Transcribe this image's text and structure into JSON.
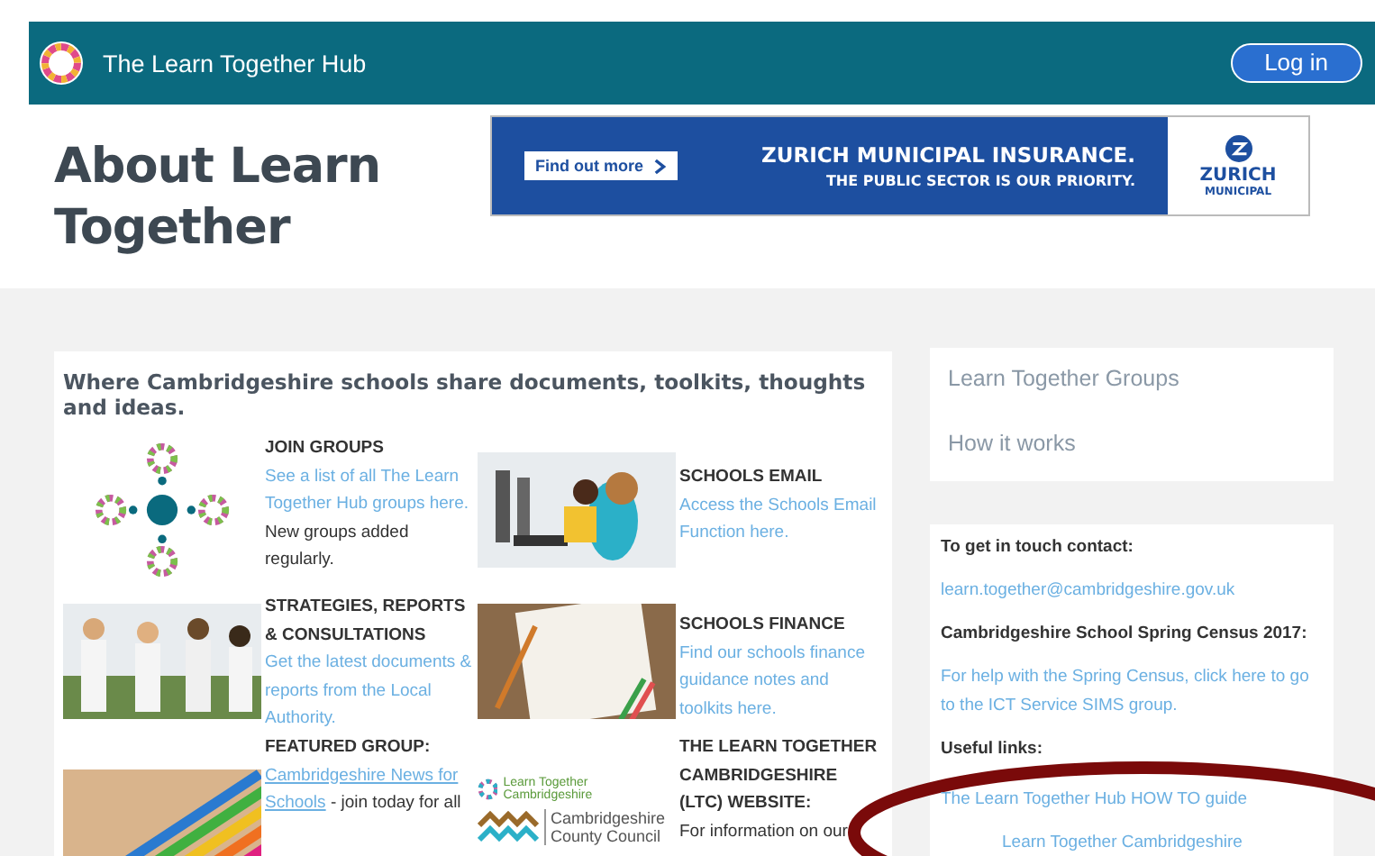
{
  "header": {
    "site_name": "The Learn Together Hub",
    "login": "Log in"
  },
  "page_title": "About Learn Together",
  "ad": {
    "button": "Find out more",
    "headline": "ZURICH MUNICIPAL INSURANCE.",
    "tagline": "THE PUBLIC SECTOR IS OUR PRIORITY.",
    "logo_name": "ZURICH",
    "logo_sub": "MUNICIPAL"
  },
  "intro": "Where Cambridgeshire schools share documents, toolkits, thoughts and ideas.",
  "features": [
    {
      "media": {
        "kind": "hub-diagram"
      },
      "title": "JOIN GROUPS",
      "body": [
        {
          "text": "See a list of all The Learn Together Hub groups here.",
          "link": true
        },
        {
          "text": "New groups added regularly.",
          "link": false
        }
      ]
    },
    {
      "media": {
        "kind": "picture"
      },
      "title": "SCHOOLS EMAIL",
      "body": [
        {
          "text": "Access the Schools Email Function here.",
          "link": true
        }
      ]
    },
    {
      "media": {
        "kind": "picture"
      },
      "title": "STRATEGIES, REPORTS & CONSULTATIONS",
      "body": [
        {
          "text": "Get the latest documents & reports from the Local Authority.",
          "link": true
        }
      ]
    },
    {
      "media": {
        "kind": "picture"
      },
      "title": "SCHOOLS FINANCE",
      "body": [
        {
          "text": "Find our schools finance guidance notes and toolkits here.",
          "link": true
        }
      ]
    },
    {
      "media": {
        "kind": "picture"
      },
      "title": "FEATURED GROUP:",
      "body": [
        {
          "text": "Cambridgeshire News for",
          "link": true
        },
        {
          "text": "Schools",
          "link": true
        },
        {
          "text": " - join today for all",
          "link": false
        }
      ]
    },
    {
      "media": {
        "kind": "logos",
        "logo_1": "Learn Together Cambridgeshire",
        "logo_2": "Cambridgeshire County Council"
      },
      "title": "THE LEARN TOGETHER CAMBRIDGESHIRE (LTC) WEBSITE:",
      "body": [
        {
          "text": "For information on our",
          "link": false
        }
      ]
    }
  ],
  "sidebar_nav": [
    "Learn Together Groups",
    "How it works"
  ],
  "contact": [
    {
      "kind": "label",
      "text": "To get in touch contact:"
    },
    {
      "kind": "link",
      "text": "learn.together@cambridgeshire.gov.uk"
    },
    {
      "kind": "label",
      "text": "Cambridgeshire School Spring Census 2017:"
    },
    {
      "kind": "link",
      "text": "For help with the Spring Census, click here to go to the ICT Service SIMS group."
    },
    {
      "kind": "label",
      "text": "Useful links:"
    },
    {
      "kind": "link",
      "text": "The Learn Together Hub HOW TO guide"
    },
    {
      "kind": "link",
      "text": "Learn Together Cambridgeshire"
    }
  ]
}
